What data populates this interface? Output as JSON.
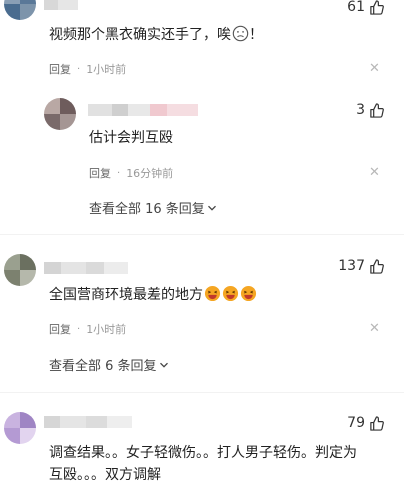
{
  "comments": [
    {
      "likes": "61",
      "text": "视频那个黑衣确实还手了，唉",
      "text_suffix": "！",
      "reply_label": "回复",
      "time": "1小时前"
    },
    {
      "likes": "3",
      "text": "估计会判互殴",
      "reply_label": "回复",
      "time": "16分钟前",
      "is_reply": true
    },
    {
      "likes": "137",
      "text": "全国营商环境最差的地方",
      "reply_label": "回复",
      "time": "1小时前"
    },
    {
      "likes": "79",
      "text_line1": "调查结果。。女子轻微伤。。打人男子轻伤。判定为",
      "text_line2": "互殴。。。双方调解"
    }
  ],
  "view_all_1": "查看全部 16 条回复",
  "view_all_2": "查看全部 6 条回复",
  "icons": {
    "like": "thumbs-up-icon",
    "close": "close-icon",
    "chevron": "chevron-down-icon",
    "emoji_sad": "sad-face-emoji",
    "emoji_laugh": "laughing-emoji"
  },
  "colors": {
    "text": "#222222",
    "meta": "#999999",
    "emoji": "#f5a623"
  }
}
